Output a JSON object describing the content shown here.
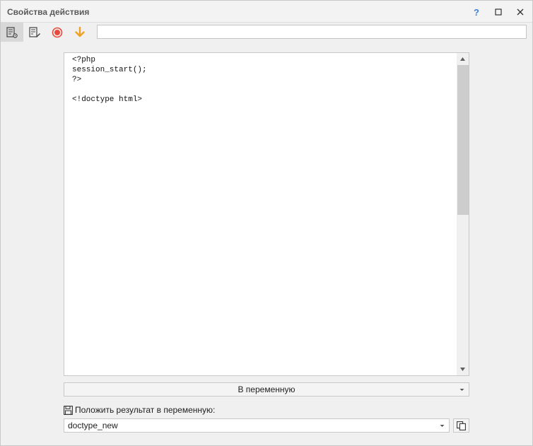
{
  "window": {
    "title": "Свойства действия",
    "help_label": "?"
  },
  "toolbar": {
    "tools": [
      {
        "icon": "action-settings-icon",
        "active": true
      },
      {
        "icon": "edit-note-icon",
        "active": false
      },
      {
        "icon": "record-icon",
        "active": false,
        "color": "#e64a3c"
      },
      {
        "icon": "arrow-down-icon",
        "active": false,
        "color": "#f0a020"
      }
    ],
    "input_value": ""
  },
  "editor": {
    "code": "<?php\nsession_start();\n?>\n\n<!doctype html>"
  },
  "mode_select": {
    "value": "В переменную"
  },
  "result": {
    "label": "Положить результат в переменную:",
    "variable": "doctype_new"
  }
}
